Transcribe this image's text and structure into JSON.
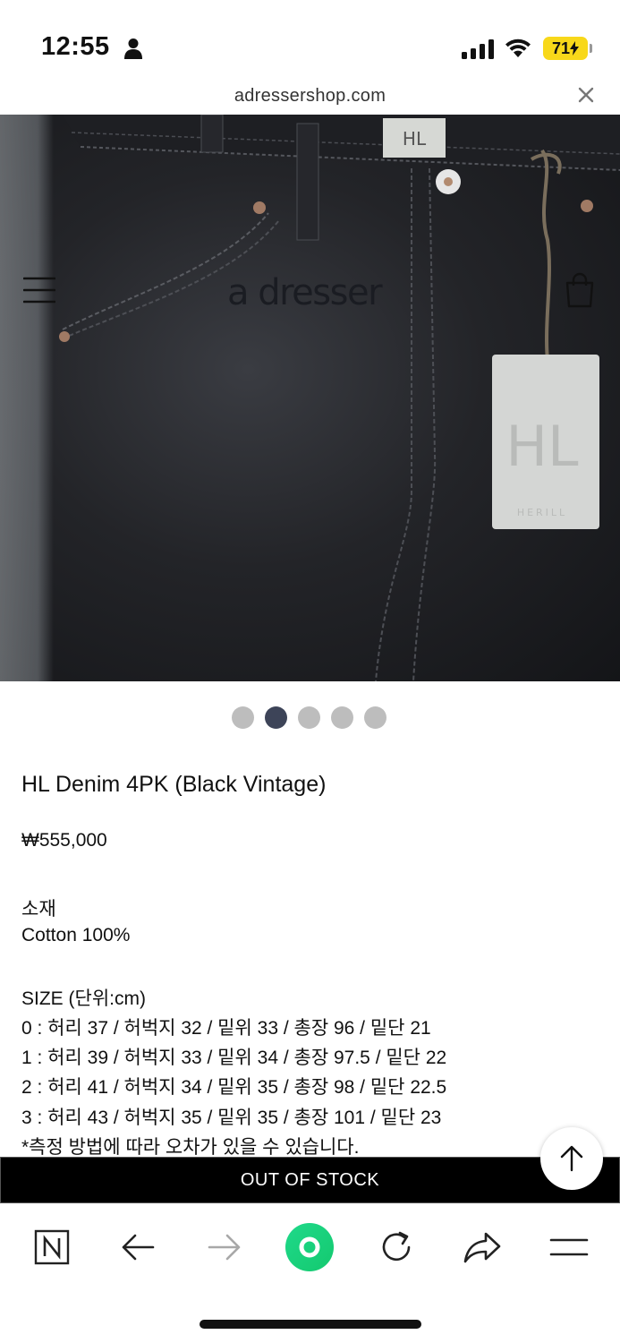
{
  "status_bar": {
    "time": "12:55",
    "battery": "71",
    "icons": [
      "person-icon",
      "signal-icon",
      "wifi-icon",
      "battery-icon"
    ]
  },
  "browser": {
    "url": "adressershop.com",
    "close_icon": "close-icon"
  },
  "site_header": {
    "logo": "a dresser",
    "menu_icon": "hamburger-menu-icon",
    "cart_icon": "shopping-bag-icon"
  },
  "carousel": {
    "total": 5,
    "active_index": 1
  },
  "product": {
    "name": "HL Denim 4PK (Black Vintage)",
    "price": "₩555,000",
    "material_title": "소재",
    "material_value": "Cotton 100%",
    "size_title": "SIZE (단위:cm)",
    "sizes": [
      "0 : 허리 37 / 허벅지 32 / 밑위 33 / 총장 96 / 밑단 21",
      "1 : 허리 39 / 허벅지 33 / 밑위 34 / 총장 97.5 / 밑단 22",
      "2 : 허리 41 / 허벅지 34 / 밑위 35 / 총장 98 / 밑단 22.5",
      "3 : 허리 43 / 허벅지 35 / 밑위 35 / 총장 101 / 밑단 23"
    ],
    "note": "*측정 방법에 따라 오차가 있을 수 있습니다."
  },
  "cta": {
    "label": "OUT OF STOCK"
  },
  "colors": {
    "accent_green": "#19d27f",
    "cta_background": "#000000",
    "active_dot": "#3d4458",
    "battery": "#f8d81a"
  },
  "toolbar": {
    "items": [
      "naver-n-icon",
      "back-arrow-icon",
      "forward-arrow-icon",
      "green-home-icon",
      "reload-icon",
      "share-icon",
      "menu-icon"
    ]
  }
}
